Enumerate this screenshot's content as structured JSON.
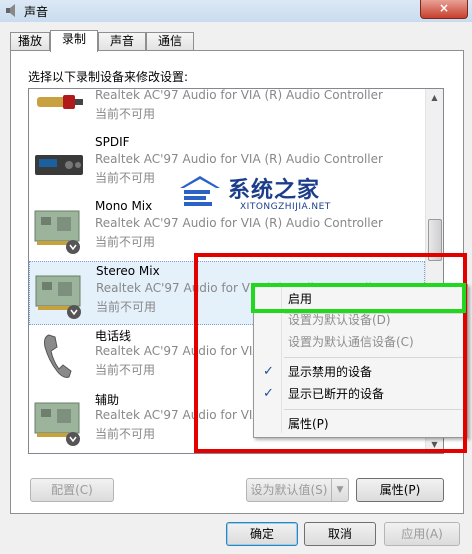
{
  "window": {
    "title": "声音",
    "close": "×"
  },
  "tabs": [
    {
      "label": "播放",
      "active": false
    },
    {
      "label": "录制",
      "active": true
    },
    {
      "label": "声音",
      "active": false
    },
    {
      "label": "通信",
      "active": false
    }
  ],
  "instruction": "选择以下录制设备来修改设置:",
  "devices": [
    {
      "name": "",
      "desc": "Realtek AC'97 Audio for VIA (R) Audio Controller",
      "status": "当前不可用",
      "icon": "rca-plug-icon"
    },
    {
      "name": "SPDIF",
      "desc": "Realtek AC'97 Audio for VIA (R) Audio Controller",
      "status": "当前不可用",
      "icon": "spdif-device-icon"
    },
    {
      "name": "Mono Mix",
      "desc": "Realtek AC'97 Audio for VIA (R) Audio Controller",
      "status": "当前不可用",
      "icon": "sound-card-icon"
    },
    {
      "name": "Stereo Mix",
      "desc": "Realtek AC'97 Audio for VIA (R) Audio Controller",
      "status": "当前不可用",
      "icon": "sound-card-icon"
    },
    {
      "name": "电话线",
      "desc": "Realtek AC'97 Audio for VIA (R) Audio Controller",
      "status": "当前不可用",
      "icon": "telephone-icon"
    },
    {
      "name": "辅助",
      "desc": "Realtek AC'97 Audio for VIA (R) Audio Controller",
      "status": "当前不可用",
      "icon": "sound-card-icon"
    }
  ],
  "context_menu": {
    "enable": "启用",
    "set_default": "设置为默认设备(D)",
    "set_default_comm": "设置为默认通信设备(C)",
    "show_disabled": "显示禁用的设备",
    "show_disconnected": "显示已断开的设备",
    "properties": "属性(P)",
    "check": "✓"
  },
  "buttons": {
    "configure": "配置(C)",
    "set_default": "设为默认值(S)",
    "dropdown": "▼",
    "properties": "属性(P)",
    "ok": "确定",
    "cancel": "取消",
    "apply": "应用(A)"
  },
  "watermark": {
    "text": "系统之家",
    "sub": "XITONGZHIJIA.NET"
  },
  "colors": {
    "highlight_red": "#e50000",
    "highlight_green": "#22d81e",
    "accent": "#1c3e8a"
  }
}
